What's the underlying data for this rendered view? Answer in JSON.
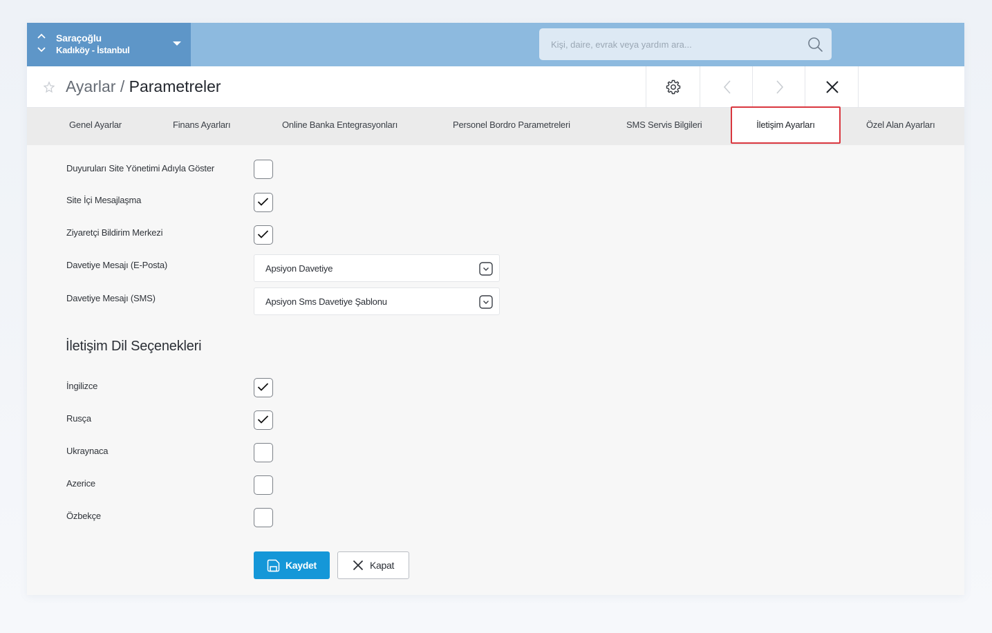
{
  "site": {
    "name": "Saraçoğlu",
    "location": "Kadıköy - İstanbul"
  },
  "search": {
    "placeholder": "Kişi, daire, evrak veya yardım ara..."
  },
  "header": {
    "breadcrumb_parent": "Ayarlar",
    "breadcrumb_separator": " / ",
    "breadcrumb_current": "Parametreler"
  },
  "tabs": [
    {
      "label": "Genel Ayarlar"
    },
    {
      "label": "Finans Ayarları"
    },
    {
      "label": "Online Banka Entegrasyonları"
    },
    {
      "label": "Personel Bordro Parametreleri"
    },
    {
      "label": "SMS Servis Bilgileri"
    },
    {
      "label": "İletişim Ayarları",
      "active": true
    },
    {
      "label": "Özel Alan Ayarları"
    }
  ],
  "settings": [
    {
      "label": "Duyuruları Site Yönetimi Adıyla Göster",
      "checked": false
    },
    {
      "label": "Site İçi Mesajlaşma",
      "checked": true
    },
    {
      "label": "Ziyaretçi Bildirim Merkezi",
      "checked": true
    }
  ],
  "invites": [
    {
      "label": "Davetiye Mesajı (E-Posta)",
      "value": "Apsiyon Davetiye"
    },
    {
      "label": "Davetiye Mesajı (SMS)",
      "value": "Apsiyon Sms Davetiye Şablonu"
    }
  ],
  "languages": {
    "title": "İletişim Dil Seçenekleri",
    "items": [
      {
        "label": "İngilizce",
        "checked": true
      },
      {
        "label": "Rusça",
        "checked": true
      },
      {
        "label": "Ukraynaca",
        "checked": false
      },
      {
        "label": "Azerice",
        "checked": false
      },
      {
        "label": "Özbekçe",
        "checked": false
      }
    ]
  },
  "actions": {
    "save_label": "Kaydet",
    "close_label": "Kapat"
  },
  "colors": {
    "topbar": "#8dbadf",
    "site_switch": "#5e96c8",
    "active_tab_border": "#d9363e",
    "primary_button": "#1597d8"
  }
}
